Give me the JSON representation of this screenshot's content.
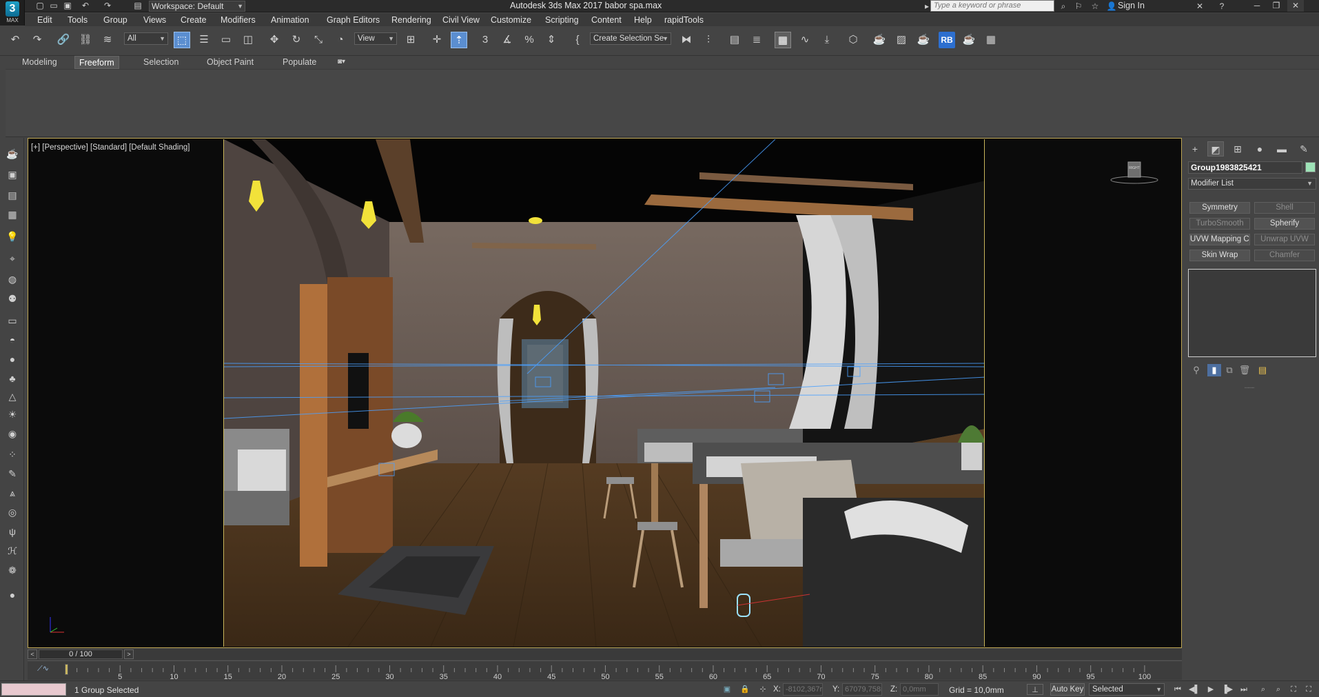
{
  "titlebar": {
    "logo_text": "MAX",
    "workspace": "Workspace: Default",
    "title": "Autodesk 3ds Max 2017      babor spa.max",
    "search_placeholder": "Type a keyword or phrase",
    "sign_in": "Sign In"
  },
  "menu": [
    "Edit",
    "Tools",
    "Group",
    "Views",
    "Create",
    "Modifiers",
    "Animation",
    "Graph Editors",
    "Rendering",
    "Civil View",
    "Customize",
    "Scripting",
    "Content",
    "Help",
    "rapidTools"
  ],
  "toolbar": {
    "filter": "All",
    "ref_coord": "View",
    "selection_set": "Create Selection Se",
    "rb_label": "RB"
  },
  "ribbon": {
    "tabs": [
      "Modeling",
      "Freeform",
      "Selection",
      "Object Paint",
      "Populate"
    ],
    "active": "Freeform"
  },
  "viewport": {
    "label": "[+] [Perspective] [Standard] [Default Shading]",
    "viewcube_label": "RIGHT"
  },
  "command_panel": {
    "object_name": "Group1983825421",
    "modifier_list": "Modifier List",
    "buttons": [
      {
        "label": "Symmetry",
        "enabled": true
      },
      {
        "label": "Shell",
        "enabled": false
      },
      {
        "label": "TurboSmooth",
        "enabled": false
      },
      {
        "label": "Spherify",
        "enabled": true
      },
      {
        "label": "UVW Mapping Clear",
        "enabled": true
      },
      {
        "label": "Unwrap UVW",
        "enabled": false
      },
      {
        "label": "Skin Wrap",
        "enabled": true
      },
      {
        "label": "Chamfer",
        "enabled": false
      }
    ],
    "colors": {
      "object_color": "#9ee3b7"
    }
  },
  "timeline": {
    "frame_display": "0 / 100",
    "ticks": [
      5,
      10,
      15,
      20,
      25,
      30,
      35,
      40,
      45,
      50,
      55,
      60,
      65,
      70,
      75,
      80,
      85,
      90,
      95,
      100
    ]
  },
  "status": {
    "selection": "1 Group Selected",
    "x_label": "X:",
    "x_value": "-8102,367r",
    "y_label": "Y:",
    "y_value": "67079,758r",
    "z_label": "Z:",
    "z_value": "0,0mm",
    "grid": "Grid = 10,0mm",
    "auto_key": "Auto Key",
    "key_filter": "Selected"
  }
}
